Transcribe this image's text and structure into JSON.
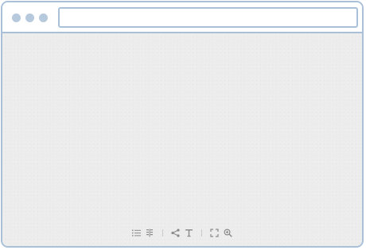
{
  "window": {
    "controls": [
      "close-dot",
      "minimize-dot",
      "maximize-dot"
    ]
  },
  "address_bar": {
    "value": "",
    "placeholder": ""
  },
  "toolbar": {
    "groups": [
      {
        "items": [
          {
            "icon": "list-icon"
          },
          {
            "icon": "grid-icon"
          }
        ]
      },
      {
        "items": [
          {
            "icon": "share-icon"
          },
          {
            "icon": "text-icon"
          }
        ]
      },
      {
        "items": [
          {
            "icon": "fullscreen-icon"
          },
          {
            "icon": "zoom-in-icon"
          }
        ]
      }
    ]
  },
  "colors": {
    "frame": "#a9c0d8",
    "dots": "#b7c9dd",
    "content_bg": "#ececec",
    "icon": "#8a8a8a"
  }
}
